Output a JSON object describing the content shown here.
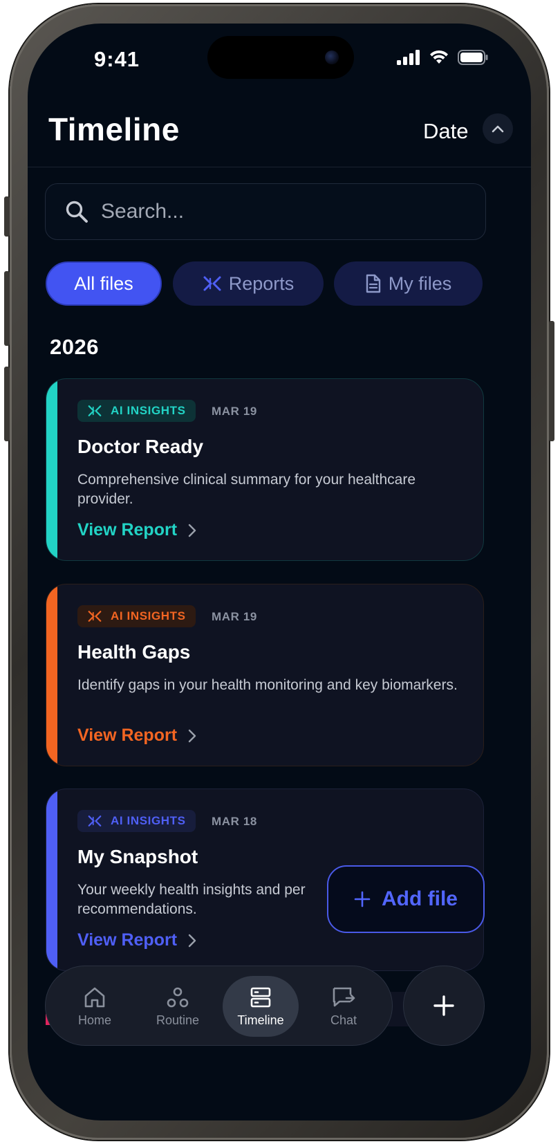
{
  "status_bar": {
    "time": "9:41"
  },
  "header": {
    "title": "Timeline",
    "sort_label": "Date"
  },
  "search": {
    "placeholder": "Search..."
  },
  "filters": [
    {
      "label": "All files",
      "active": true
    },
    {
      "label": "Reports",
      "active": false,
      "icon": "insights-icon"
    },
    {
      "label": "My files",
      "active": false,
      "icon": "document-icon"
    }
  ],
  "year": "2026",
  "cards": [
    {
      "badge": "AI INSIGHTS",
      "date": "MAR 19",
      "title": "Doctor Ready",
      "description": "Comprehensive clinical summary for your healthcare provider.",
      "link": "View Report",
      "accent": "#22d3c5"
    },
    {
      "badge": "AI INSIGHTS",
      "date": "MAR 19",
      "title": "Health Gaps",
      "description": "Identify gaps in your health monitoring and key biomarkers.",
      "link": "View Report",
      "accent": "#f26522"
    },
    {
      "badge": "AI INSIGHTS",
      "date": "MAR 18",
      "title": "My Snapshot",
      "description": "Your weekly health insights and per",
      "description_line2": "recommendations.",
      "link": "View Report",
      "accent": "#4f5ff5"
    }
  ],
  "add_file": {
    "label": "Add file"
  },
  "tabs": [
    {
      "label": "Home",
      "icon": "home-icon"
    },
    {
      "label": "Routine",
      "icon": "routine-icon"
    },
    {
      "label": "Timeline",
      "icon": "timeline-icon",
      "active": true
    },
    {
      "label": "Chat",
      "icon": "chat-icon"
    }
  ]
}
